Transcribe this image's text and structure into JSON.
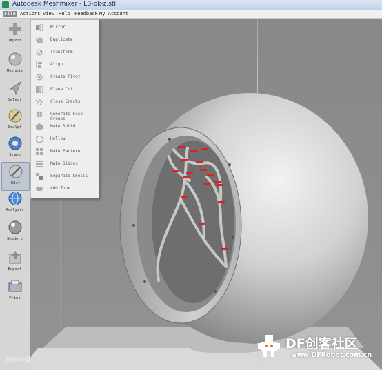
{
  "window": {
    "title": "Autodesk Meshmixer - LB-ok-z.stl"
  },
  "menubar": {
    "items": [
      "File",
      "Actions",
      "View",
      "Help",
      "Feedback",
      "My Account"
    ],
    "active": "File"
  },
  "toolbar": {
    "tools": [
      {
        "label": "Import",
        "icon": "plus-icon"
      },
      {
        "label": "Meshmix",
        "icon": "meshmix-sphere-icon"
      },
      {
        "label": "Select",
        "icon": "select-arrow-icon"
      },
      {
        "label": "Sculpt",
        "icon": "sculpt-brush-icon"
      },
      {
        "label": "Stamp",
        "icon": "stamp-icon"
      },
      {
        "label": "Edit",
        "icon": "edit-icon"
      },
      {
        "label": "Analysis",
        "icon": "analysis-globe-icon"
      },
      {
        "label": "Shaders",
        "icon": "shader-sphere-icon"
      },
      {
        "label": "Export",
        "icon": "export-icon"
      },
      {
        "label": "Print",
        "icon": "print-icon"
      }
    ],
    "active": "Edit"
  },
  "edit_menu": {
    "items": [
      {
        "label": "Mirror",
        "icon": "mirror-icon"
      },
      {
        "label": "Duplicate",
        "icon": "duplicate-icon"
      },
      {
        "label": "Transform",
        "icon": "transform-icon"
      },
      {
        "label": "Align",
        "icon": "align-icon"
      },
      {
        "label": "Create Pivot",
        "icon": "pivot-icon"
      },
      {
        "label": "Plane Cut",
        "icon": "plane-cut-icon"
      },
      {
        "label": "Close Cracks",
        "icon": "close-cracks-icon"
      },
      {
        "label": "Generate Face Groups",
        "icon": "face-groups-icon"
      },
      {
        "label": "Make Solid",
        "icon": "make-solid-icon"
      },
      {
        "label": "Hollow",
        "icon": "hollow-icon"
      },
      {
        "label": "Make Pattern",
        "icon": "make-pattern-icon"
      },
      {
        "label": "Make Slices",
        "icon": "make-slices-icon"
      },
      {
        "label": "Separate Shells",
        "icon": "separate-shells-icon"
      },
      {
        "label": "Add Tube",
        "icon": "add-tube-icon"
      }
    ]
  },
  "watermarks": {
    "left": "数码网摄",
    "brand": "DF创客社区",
    "url": "www.DFRobot.com.cn"
  },
  "colors": {
    "accent_red": "#e02020",
    "brand_orange": "#f36f21"
  }
}
